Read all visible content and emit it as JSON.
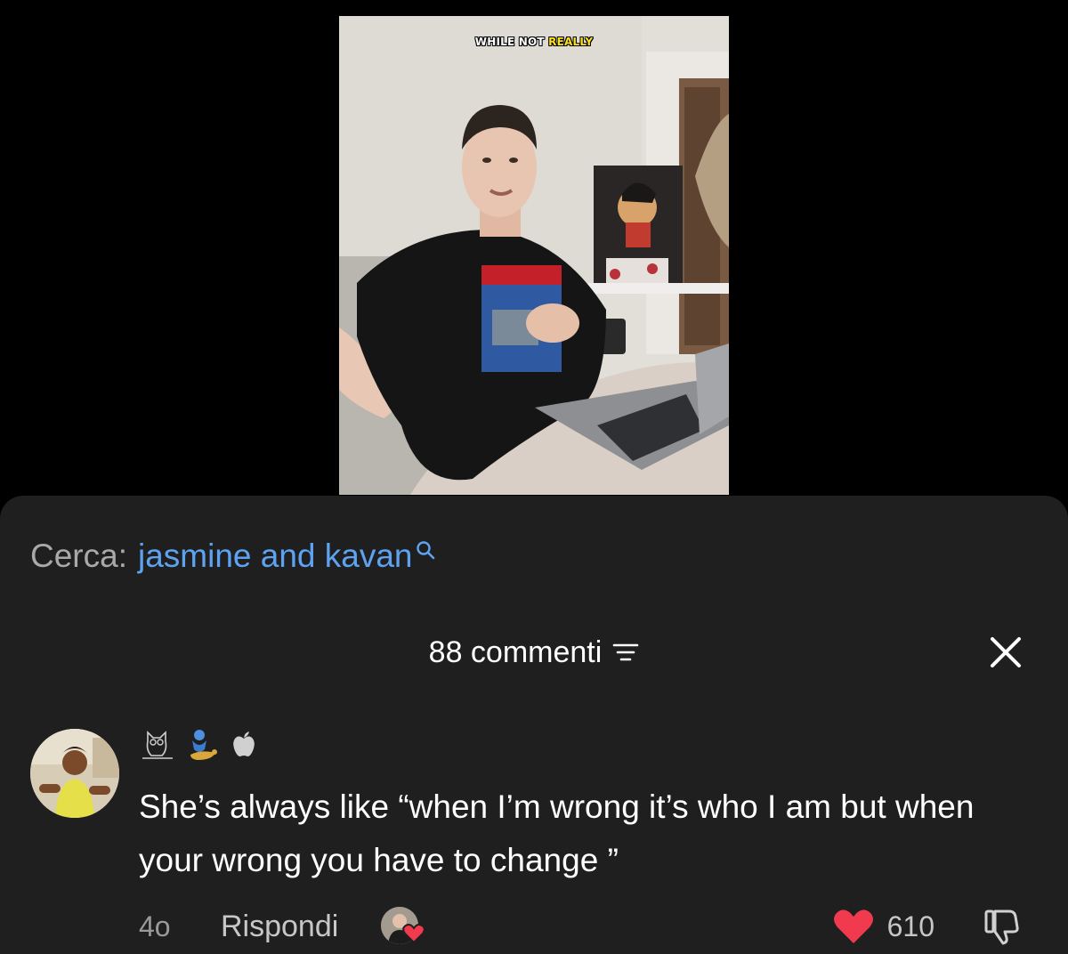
{
  "video": {
    "caption_white": "WHILE NOT",
    "caption_highlight": "REALLY"
  },
  "search": {
    "prefix": "Cerca:",
    "term": "jasmine and kavan",
    "icon": "search-icon"
  },
  "comments_header": {
    "count_label": "88 commenti",
    "filter_icon": "filter-icon",
    "close_icon": "close-icon"
  },
  "comment": {
    "badges": [
      "owl-icon",
      "genie-icon",
      "apple-icon"
    ],
    "text": "She’s always like “when I’m wrong it’s who I am but when your wrong you have to change ”",
    "time": "4o",
    "reply_label": "Rispondi",
    "like_count": "610",
    "liked": true
  },
  "colors": {
    "sheet_bg": "#1f1f1f",
    "link_blue": "#5ea3f2",
    "heart_red": "#f23a4f",
    "caption_yellow": "#ffe11a"
  }
}
